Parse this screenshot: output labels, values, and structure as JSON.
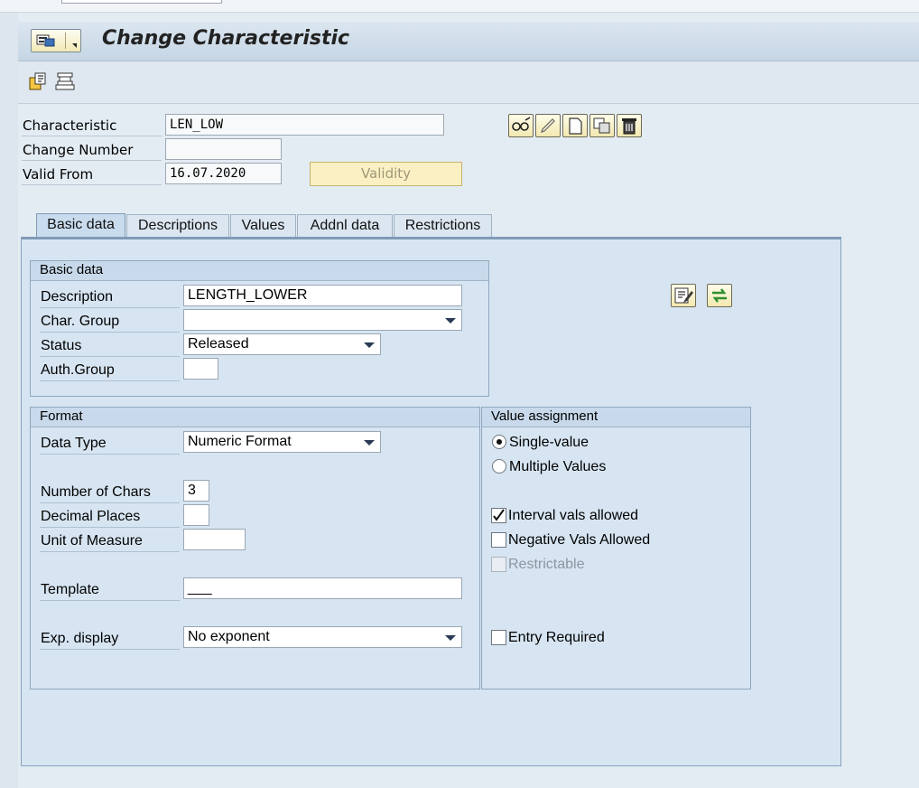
{
  "window": {
    "title": "Change Characteristic"
  },
  "header": {
    "characteristic_label": "Characteristic",
    "characteristic_value": "LEN_LOW",
    "change_number_label": "Change Number",
    "change_number_value": "",
    "valid_from_label": "Valid From",
    "valid_from_value": "16.07.2020",
    "validity_button": "Validity"
  },
  "tabs": [
    {
      "label": "Basic data",
      "active": true
    },
    {
      "label": "Descriptions",
      "active": false
    },
    {
      "label": "Values",
      "active": false
    },
    {
      "label": "Addnl data",
      "active": false
    },
    {
      "label": "Restrictions",
      "active": false
    }
  ],
  "basic_data": {
    "title": "Basic data",
    "description_label": "Description",
    "description_value": "LENGTH_LOWER",
    "char_group_label": "Char. Group",
    "char_group_value": "",
    "status_label": "Status",
    "status_value": "Released",
    "auth_group_label": "Auth.Group",
    "auth_group_value": ""
  },
  "format": {
    "title": "Format",
    "data_type_label": "Data Type",
    "data_type_value": "Numeric Format",
    "num_chars_label": "Number of Chars",
    "num_chars_value": "3",
    "decimal_places_label": "Decimal Places",
    "decimal_places_value": "",
    "unit_label": "Unit of Measure",
    "unit_value": "",
    "template_label": "Template",
    "template_value": "___",
    "exp_display_label": "Exp. display",
    "exp_display_value": "No exponent"
  },
  "value_assignment": {
    "title": "Value assignment",
    "single_value": "Single-value",
    "multiple_values": "Multiple Values",
    "interval_vals": "Interval vals allowed",
    "negative_vals": "Negative Vals Allowed",
    "restrictable": "Restrictable",
    "entry_required": "Entry Required"
  },
  "icons": {
    "menu": "menu-icon",
    "toolbar": [
      "other-object-icon",
      "classes-icon"
    ],
    "header_actions": [
      "display-change-icon",
      "edit-pencil-icon",
      "create-icon",
      "copy-icon",
      "delete-icon"
    ],
    "basic_actions": [
      "edit-text-icon",
      "switch-icon"
    ]
  },
  "colors": {
    "background": "#e4ecf3",
    "panel": "#d7e5f2",
    "button_yellow": "#f2e8b0"
  }
}
